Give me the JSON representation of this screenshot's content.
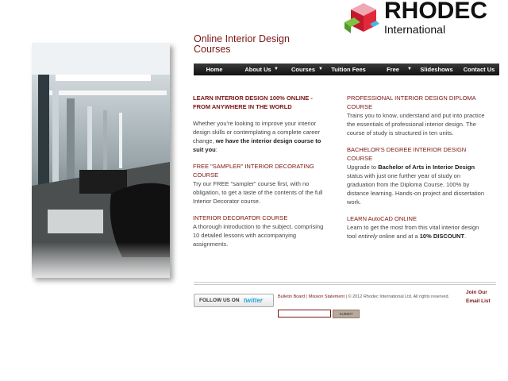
{
  "brand": {
    "name": "RHODEC",
    "sub": "International"
  },
  "page": {
    "title_line1": "Online Interior Design",
    "title_line2": "Courses"
  },
  "nav": [
    {
      "label": "Home",
      "dropdown": false
    },
    {
      "label": "About Us",
      "dropdown": true
    },
    {
      "label": "Courses",
      "dropdown": true
    },
    {
      "label": "Tuition Fees",
      "dropdown": false
    },
    {
      "label": "Free",
      "dropdown": true
    },
    {
      "label": "Slideshows",
      "dropdown": false
    },
    {
      "label": "Contact Us",
      "dropdown": false
    }
  ],
  "left": {
    "heading": "LEARN INTERIOR DESIGN 100% ONLINE - FROM ANYWHERE IN THE WORLD",
    "intro_plain": "Whether you're looking to improve your interior design skills or contemplating a complete career change, ",
    "intro_bold": "we have the interior design course to suit you",
    "intro_end": ":",
    "sampler_title": "FREE \"SAMPLER\" INTERIOR DECORATING COURSE",
    "sampler_body": "Try our FREE \"sampler\" course first, with no obligation, to get a taste of the contents of the full Interior Decorator course.",
    "decorator_title": "INTERIOR DECORATOR COURSE",
    "decorator_body": "A thorough introduction to the subject, comprising 10 detailed lessons with accompanying assignments."
  },
  "right": {
    "diploma_title": "PROFESSIONAL INTERIOR DESIGN DIPLOMA COURSE",
    "diploma_body": "Trains you to know, understand and put into practice the essentials of professional interior design. The course of study is structured in ten units.",
    "bachelor_title": "BACHELOR'S DEGREE INTERIOR DESIGN COURSE",
    "bachelor_pre": "Upgrade to ",
    "bachelor_bold": "Bachelor of Arts in Interior Design",
    "bachelor_post": " status with just one further year of study on graduation from the Diploma Course. 100% by distance learning. Hands-on project and dissertation work.",
    "autocad_title": "LEARN AutoCAD ONLINE",
    "autocad_pre": "Learn to get the most from this vital interior design tool ",
    "autocad_italic": "entirely",
    "autocad_mid": " online and at a ",
    "autocad_bold": "10% DISCOUNT",
    "autocad_end": "."
  },
  "footer": {
    "twitter_label": "FOLLOW US ON",
    "twitter_brand": "twitter",
    "bulletin": "Bulletin Board",
    "sep": " | ",
    "mission": "Mission Statement",
    "copyright": " | © 2012 Rhodec International Ltd. All rights reserved.",
    "join_line1": "Join Our",
    "join_line2": "Email List",
    "submit_label": "SUBMIT",
    "email_value": ""
  },
  "colors": {
    "accent": "#7a1515",
    "nav_bg": "#1a1a1a",
    "twitter_blue": "#2aa3d8"
  }
}
